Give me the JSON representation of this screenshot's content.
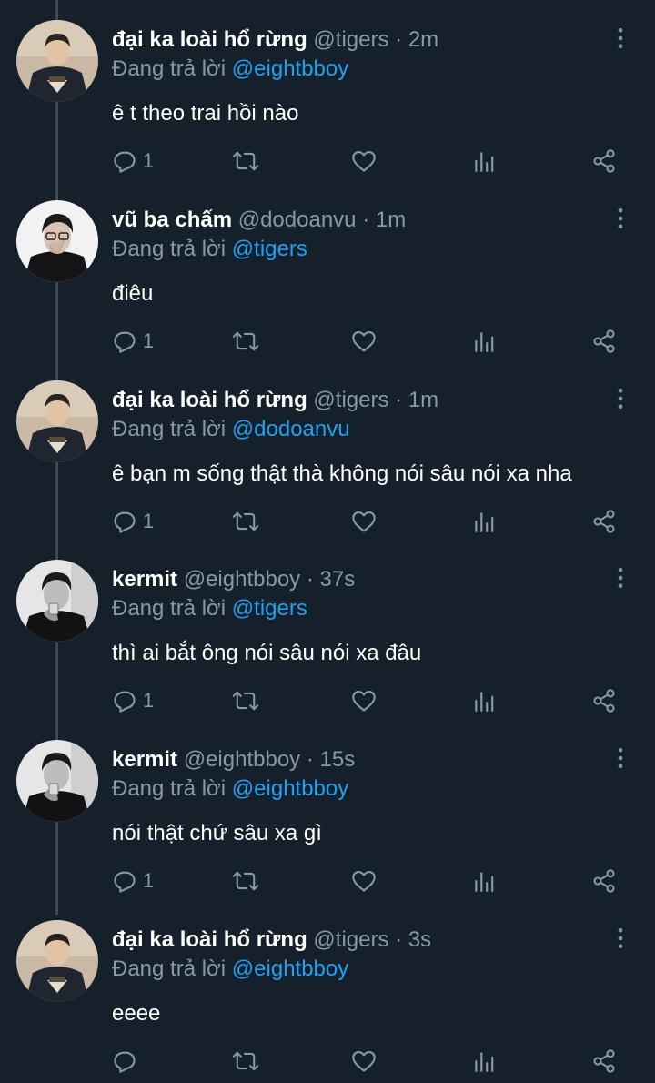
{
  "tweets": [
    {
      "name": "đại ka loài hổ rừng",
      "handle": "@tigers",
      "time": "2m",
      "replying_prefix": "Đang trả lời",
      "replying_to": "@eightbboy",
      "text": "ê t theo trai hồi nào",
      "reply_count": "1",
      "avatar": "avatar-tigers"
    },
    {
      "name": "vũ ba chấm",
      "handle": "@dodoanvu",
      "time": "1m",
      "replying_prefix": "Đang trả lời",
      "replying_to": "@tigers",
      "text": "điêu",
      "reply_count": "1",
      "avatar": "avatar-dodoanvu"
    },
    {
      "name": "đại ka loài hổ rừng",
      "handle": "@tigers",
      "time": "1m",
      "replying_prefix": "Đang trả lời",
      "replying_to": "@dodoanvu",
      "text": "ê bạn m sống thật thà không nói sâu nói xa nha",
      "reply_count": "1",
      "avatar": "avatar-tigers"
    },
    {
      "name": "kermit",
      "handle": "@eightbboy",
      "time": "37s",
      "replying_prefix": "Đang trả lời",
      "replying_to": "@tigers",
      "text": "thì ai bắt ông nói sâu nói xa đâu",
      "reply_count": "1",
      "avatar": "avatar-eightbboy"
    },
    {
      "name": "kermit",
      "handle": "@eightbboy",
      "time": "15s",
      "replying_prefix": "Đang trả lời",
      "replying_to": "@eightbboy",
      "text": "nói thật chứ sâu xa gì",
      "reply_count": "1",
      "avatar": "avatar-eightbboy"
    },
    {
      "name": "đại ka loài hổ rừng",
      "handle": "@tigers",
      "time": "3s",
      "replying_prefix": "Đang trả lời",
      "replying_to": "@eightbboy",
      "text": "eeee",
      "reply_count": "",
      "avatar": "avatar-tigers"
    }
  ],
  "dot": "·",
  "icons": {
    "reply": "reply-icon",
    "retweet": "retweet-icon",
    "like": "like-icon",
    "analytics": "analytics-icon",
    "share": "share-icon",
    "more": "more-icon"
  },
  "colors": {
    "background": "#15202b",
    "link": "#1da1f2",
    "muted": "#8899a6",
    "thread_line": "#3b4a57"
  }
}
